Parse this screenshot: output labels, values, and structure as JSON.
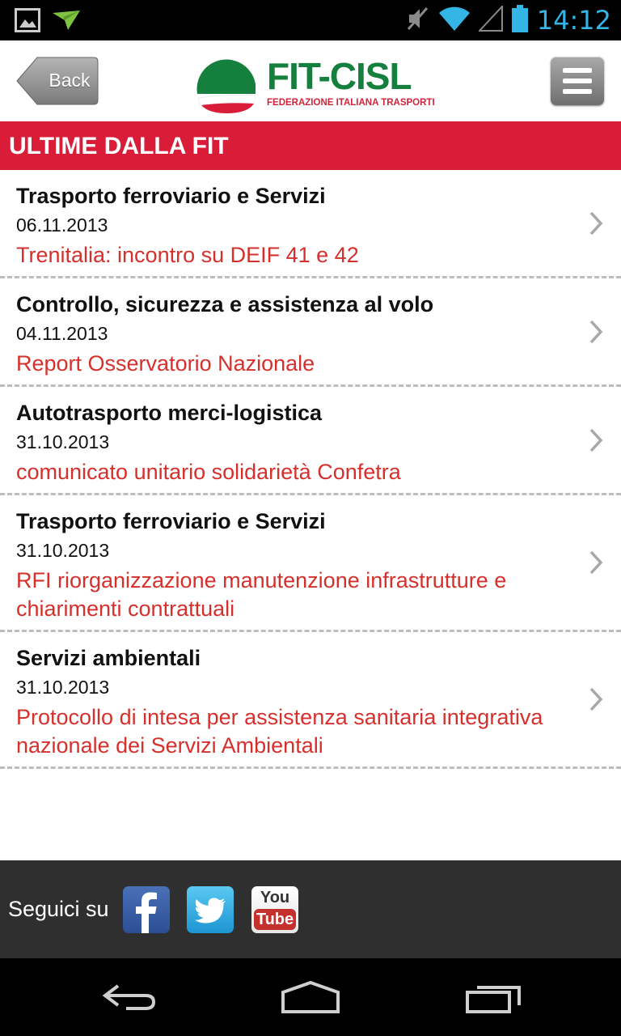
{
  "status_bar": {
    "time": "14:12",
    "icons": [
      "picture-icon",
      "send-icon",
      "mute-icon",
      "wifi-icon",
      "signal-icon",
      "battery-icon"
    ]
  },
  "header": {
    "back_label": "Back",
    "logo_name": "FIT-CISL",
    "logo_subtitle": "FEDERAZIONE ITALIANA TRASPORTI",
    "menu_icon": "menu-icon"
  },
  "section": {
    "title": "ULTIME DALLA FIT"
  },
  "news": [
    {
      "category": "Trasporto ferroviario e Servizi",
      "date": "06.11.2013",
      "title": "Trenitalia: incontro su DEIF 41 e 42"
    },
    {
      "category": "Controllo, sicurezza e assistenza al volo",
      "date": "04.11.2013",
      "title": "Report Osservatorio Nazionale"
    },
    {
      "category": "Autotrasporto merci-logistica",
      "date": "31.10.2013",
      "title": "comunicato unitario  solidarietà Confetra"
    },
    {
      "category": "Trasporto ferroviario e Servizi",
      "date": "31.10.2013",
      "title": "RFI riorganizzazione manutenzione infrastrutture e chiarimenti contrattuali"
    },
    {
      "category": "Servizi ambientali",
      "date": "31.10.2013",
      "title": "Protocollo di intesa per assistenza sanitaria integrativa nazionale dei Servizi Ambientali"
    }
  ],
  "footer": {
    "follow_label": "Seguici su",
    "youtube_you": "You",
    "youtube_tube": "Tube"
  },
  "colors": {
    "brand_red": "#d91c38",
    "brand_green": "#15803d",
    "link_red": "#d6302d"
  }
}
